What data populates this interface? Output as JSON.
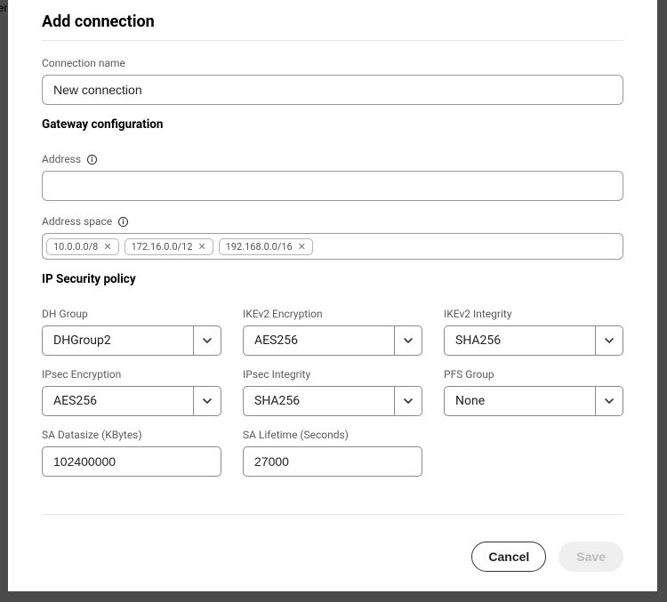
{
  "edge_text": "er",
  "title": "Add connection",
  "connection_name": {
    "label": "Connection name",
    "value": "New connection"
  },
  "gateway": {
    "section": "Gateway configuration",
    "address_label": "Address",
    "address_value": "",
    "address_space_label": "Address space",
    "tags": [
      "10.0.0.0/8",
      "172.16.0.0/12",
      "192.168.0.0/16"
    ]
  },
  "ipsec": {
    "section": "IP Security policy",
    "dh_group": {
      "label": "DH Group",
      "value": "DHGroup2"
    },
    "ikev2_encryption": {
      "label": "IKEv2 Encryption",
      "value": "AES256"
    },
    "ikev2_integrity": {
      "label": "IKEv2 Integrity",
      "value": "SHA256"
    },
    "ipsec_encryption": {
      "label": "IPsec Encryption",
      "value": "AES256"
    },
    "ipsec_integrity": {
      "label": "IPsec Integrity",
      "value": "SHA256"
    },
    "pfs_group": {
      "label": "PFS Group",
      "value": "None"
    },
    "sa_datasize": {
      "label": "SA Datasize (KBytes)",
      "value": "102400000"
    },
    "sa_lifetime": {
      "label": "SA Lifetime (Seconds)",
      "value": "27000"
    }
  },
  "buttons": {
    "cancel": "Cancel",
    "save": "Save"
  }
}
